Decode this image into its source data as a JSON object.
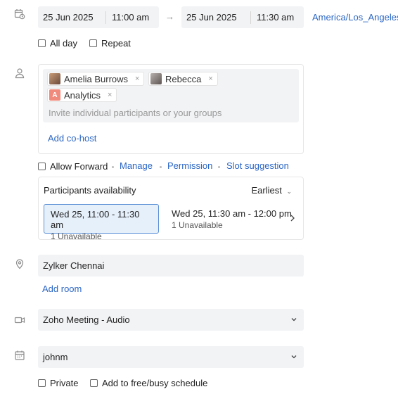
{
  "datetime": {
    "start_date": "25 Jun 2025",
    "start_time": "11:00 am",
    "arrow": "→",
    "end_date": "25 Jun 2025",
    "end_time": "11:30 am",
    "timezone": "America/Los_Angeles"
  },
  "options": {
    "all_day": "All day",
    "repeat": "Repeat"
  },
  "participants": {
    "chips": [
      {
        "name": "Amelia Burrows",
        "remove": "×"
      },
      {
        "name": "Rebecca",
        "remove": "×"
      },
      {
        "name": "Analytics",
        "initial": "A",
        "remove": "×"
      }
    ],
    "placeholder": "Invite individual participants or your groups",
    "add_cohost": "Add co-host"
  },
  "actions": {
    "allow_forward": "Allow Forward",
    "manage": "Manage",
    "permission": "Permission",
    "slot_suggestion": "Slot suggestion"
  },
  "availability": {
    "title": "Participants availability",
    "sort": "Earliest",
    "slots": [
      {
        "time": "Wed 25, 11:00 - 11:30 am",
        "status": "1 Unavailable"
      },
      {
        "time": "Wed 25, 11:30 am - 12:00 pm",
        "status": "1 Unavailable"
      }
    ]
  },
  "location": {
    "value": "Zylker Chennai",
    "add_room": "Add room"
  },
  "meeting": {
    "value": "Zoho Meeting - Audio"
  },
  "calendar": {
    "value": "johnm"
  },
  "footer": {
    "private": "Private",
    "free_busy": "Add to free/busy schedule"
  },
  "colors": {
    "link": "#2b66c4",
    "selected_slot_bg": "#e6f0fb",
    "selected_slot_border": "#5b8fd6",
    "analytics_avatar": "#f08a7d"
  }
}
